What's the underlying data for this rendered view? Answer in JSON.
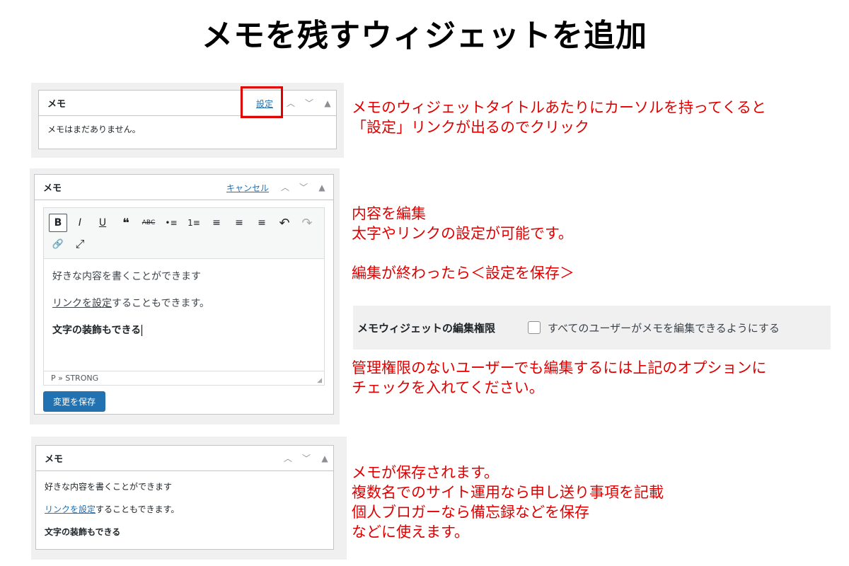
{
  "title": "メモを残すウィジェットを追加",
  "step1": {
    "widget_title": "メモ",
    "settings_link": "設定",
    "empty_text": "メモはまだありません。",
    "note_lines": [
      "メモのウィジェットタイトルあたりにカーソルを持ってくると",
      "「設定」リンクが出るのでクリック"
    ]
  },
  "step2": {
    "widget_title": "メモ",
    "cancel_link": "キャンセル",
    "toolbar": [
      "B",
      "I",
      "U",
      "❝",
      "ABC",
      "•≡",
      "1≡",
      "≡",
      "≡",
      "≡",
      "↶",
      "↷",
      "🔗",
      "⤢"
    ],
    "content": {
      "line1": "好きな内容を書くことができます",
      "line2_link": "リンクを設定",
      "line2_rest": "することもできます。",
      "line3": "文字の装飾もできる"
    },
    "status_path": "P » STRONG",
    "save_button": "変更を保存",
    "note_lines": [
      "内容を編集",
      "太字やリンクの設定が可能です。",
      "",
      "編集が終わったら＜設定を保存＞"
    ]
  },
  "permission": {
    "label": "メモウィジェットの編集権限",
    "checkbox_text": "すべてのユーザーがメモを編集できるようにする",
    "note_lines": [
      "管理権限のないユーザーでも編集するには上記のオプションに",
      "チェックを入れてください。"
    ]
  },
  "step3": {
    "widget_title": "メモ",
    "line1": "好きな内容を書くことができます",
    "line2_link": "リンクを設定",
    "line2_rest": "することもできます。",
    "line3": "文字の装飾もできる",
    "note_lines": [
      "メモが保存されます。",
      "複数名でのサイト運用なら申し送り事項を記載",
      "個人ブロガーなら備忘録などを保存",
      "などに使えます。"
    ]
  }
}
